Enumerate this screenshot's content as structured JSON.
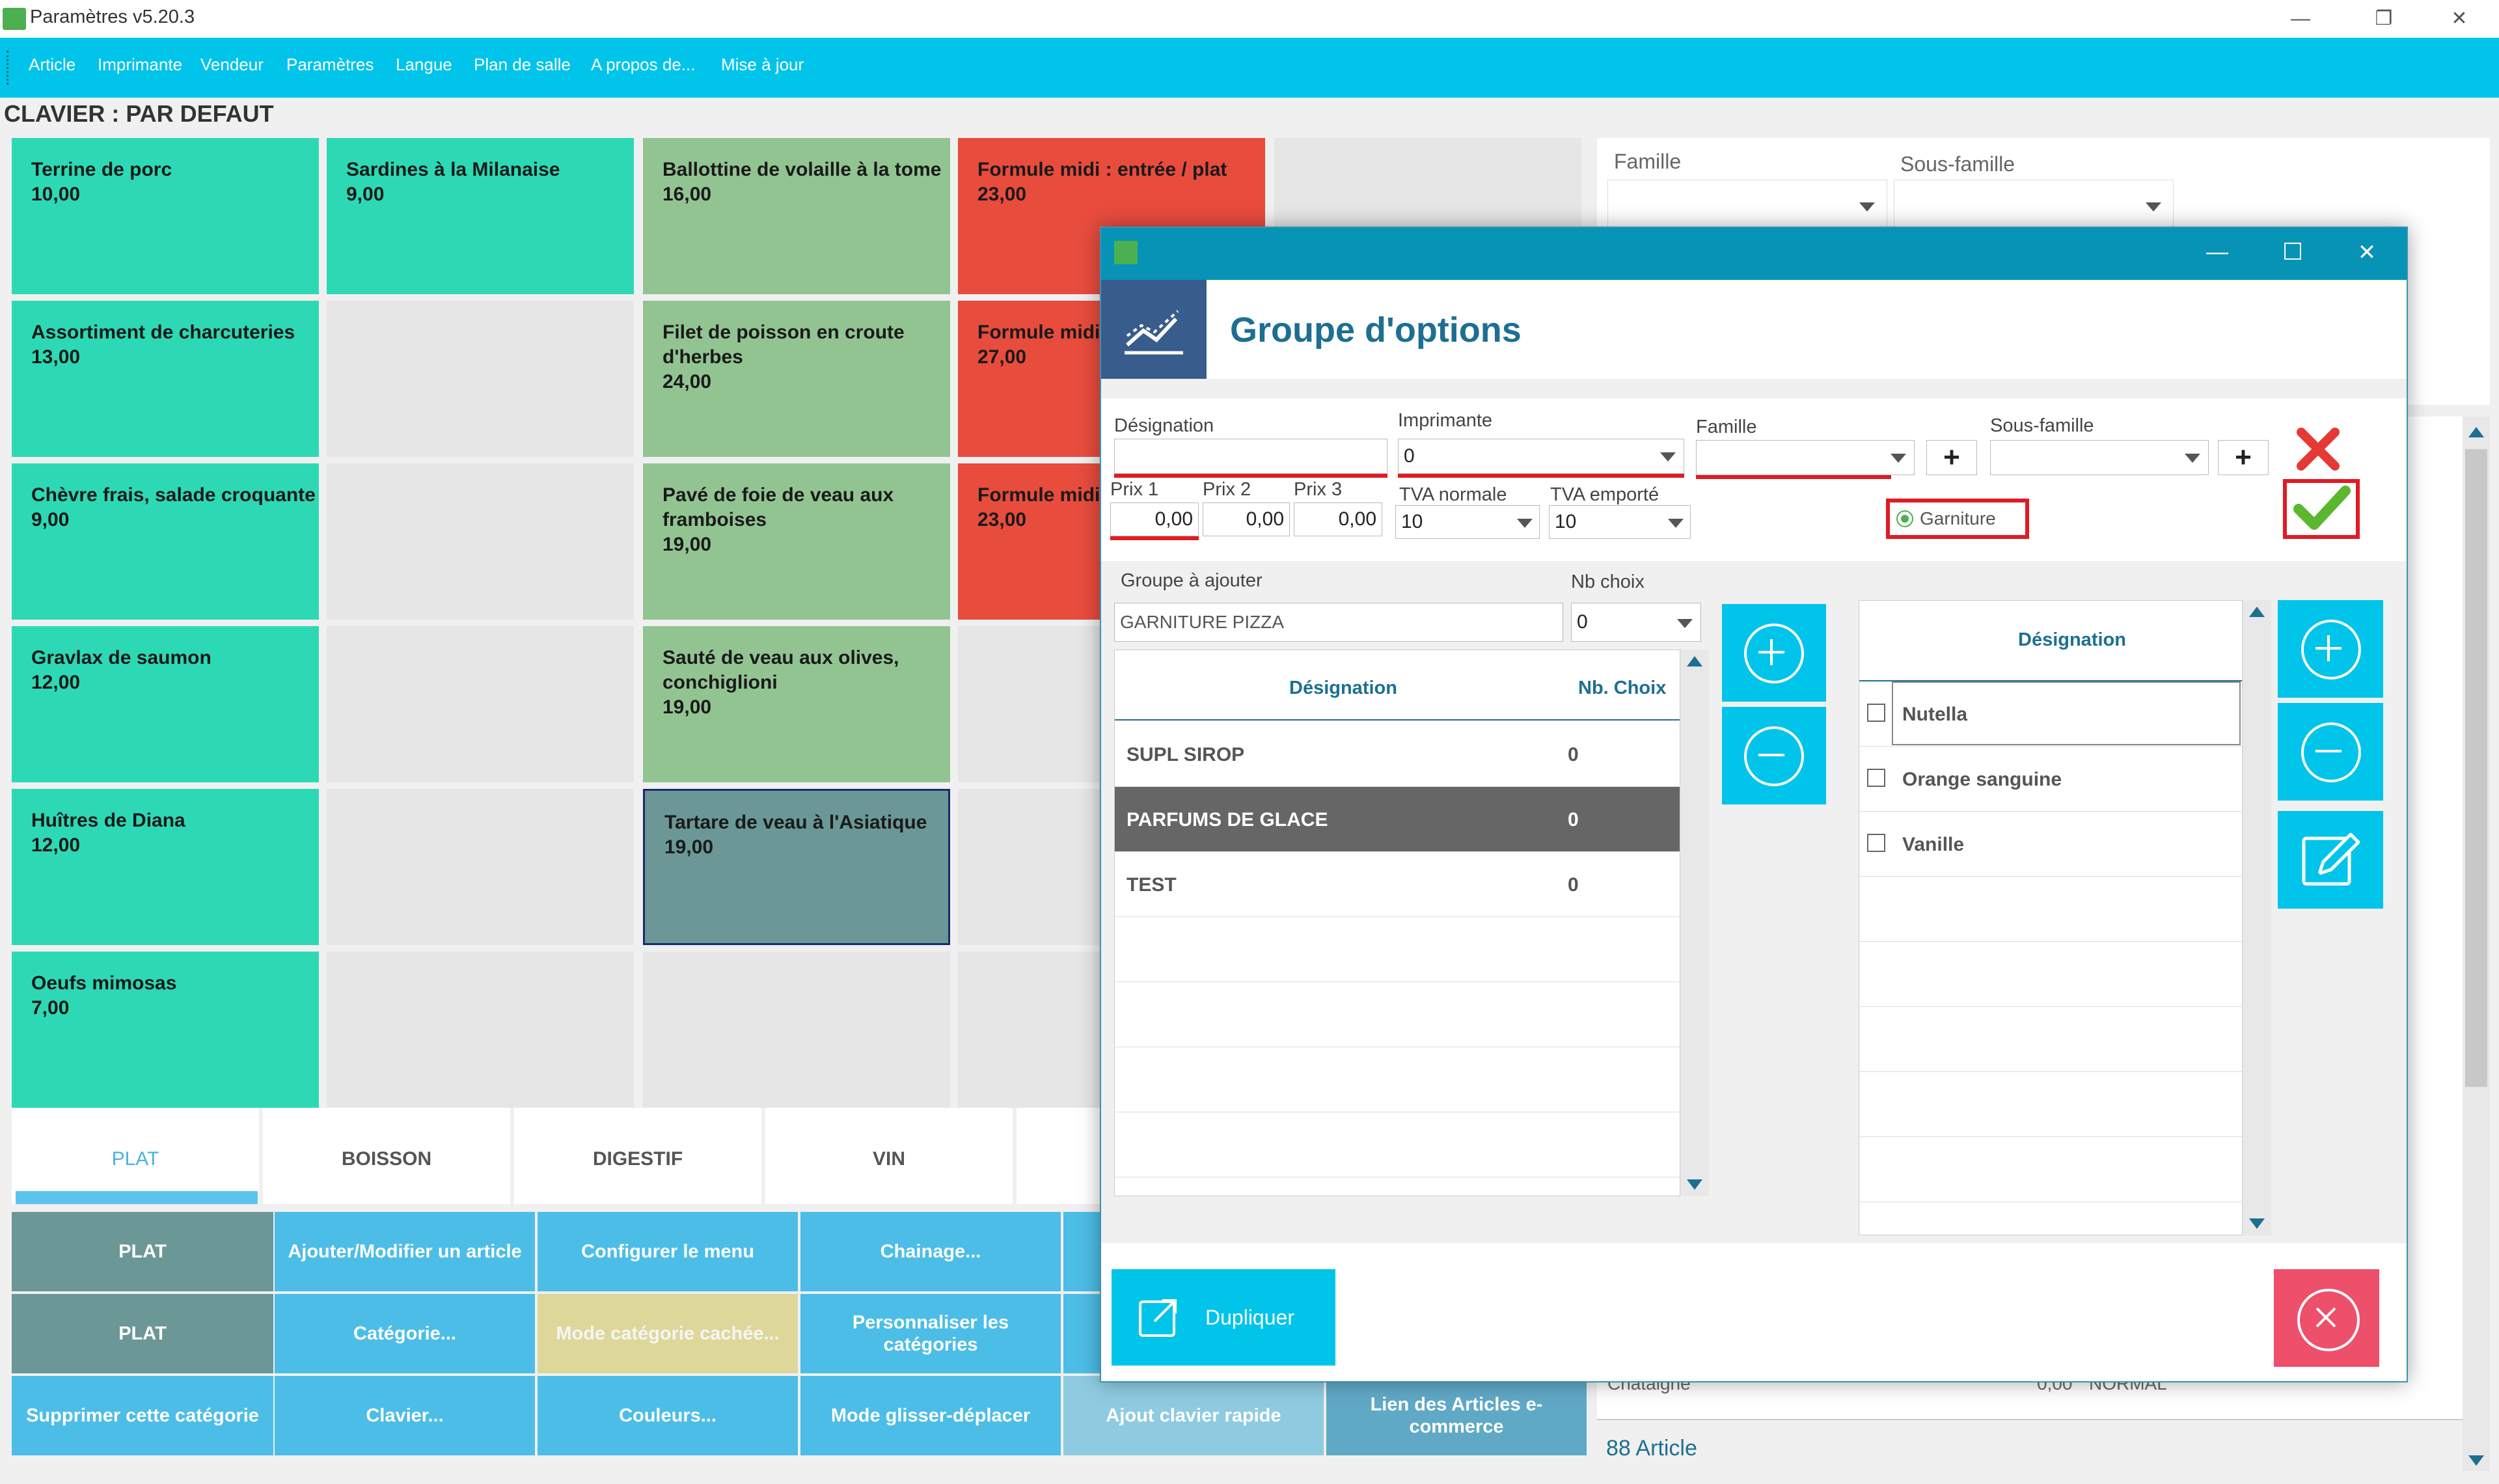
{
  "window": {
    "title": "Paramètres v5.20.3",
    "minimize": "—",
    "restore": "❐",
    "close": "✕"
  },
  "menu": [
    "Article",
    "Imprimante",
    "Vendeur",
    "Paramètres",
    "Langue",
    "Plan de salle",
    "A propos de...",
    "Mise à jour"
  ],
  "keyboard_title": "CLAVIER : PAR DEFAUT",
  "tiles": [
    {
      "name": "Terrine de porc",
      "price": "10,00"
    },
    {
      "name": "Sardines à la Milanaise",
      "price": "9,00"
    },
    {
      "name": "Ballottine de volaille à la tome",
      "price": "16,00"
    },
    {
      "name": "Formule midi : entrée / plat",
      "price": "23,00"
    },
    {
      "name": "Assortiment de charcuteries",
      "price": "13,00"
    },
    {
      "name": "Filet de poisson en croute d'herbes",
      "price": "24,00"
    },
    {
      "name": "Formule midi dessert",
      "price": "27,00"
    },
    {
      "name": "Chèvre frais, salade croquante",
      "price": "9,00"
    },
    {
      "name": "Pavé de foie de veau aux framboises",
      "price": "19,00"
    },
    {
      "name": "Formule midi",
      "price": "23,00"
    },
    {
      "name": "Gravlax de saumon",
      "price": "12,00"
    },
    {
      "name": "Sauté de veau aux olives, conchiglioni",
      "price": "19,00"
    },
    {
      "name": "Huîtres de Diana",
      "price": "12,00"
    },
    {
      "name": "Tartare de veau à l'Asiatique",
      "price": "19,00"
    },
    {
      "name": "Oeufs mimosas",
      "price": "7,00"
    }
  ],
  "category_tabs": [
    "PLAT",
    "BOISSON",
    "DIGESTIF",
    "VIN"
  ],
  "actions": {
    "r1": [
      "PLAT",
      "Ajouter/Modifier un article",
      "Configurer le menu",
      "Chainage..."
    ],
    "r2": [
      "PLAT",
      "Catégorie...",
      "Mode catégorie cachée...",
      "Personnaliser les catégories"
    ],
    "r3": [
      "Supprimer cette catégorie",
      "Clavier...",
      "Couleurs...",
      "Mode glisser-déplacer",
      "Ajout clavier rapide",
      "Lien des Articles e-commerce"
    ]
  },
  "right_panel": {
    "famille_label": "Famille",
    "sous_famille_label": "Sous-famille",
    "row_partial": "Chataigne",
    "row_partial_price": "0,00",
    "row_partial_type": "NORMAL",
    "footer": "88 Article"
  },
  "dialog": {
    "title": "Groupe d'options",
    "designation_label": "Désignation",
    "designation_value": "",
    "imprimante_label": "Imprimante",
    "imprimante_value": "0",
    "famille_label": "Famille",
    "sous_famille_label": "Sous-famille",
    "prix1_label": "Prix 1",
    "prix2_label": "Prix 2",
    "prix3_label": "Prix 3",
    "prix1": "0,00",
    "prix2": "0,00",
    "prix3": "0,00",
    "tva_normale_label": "TVA normale",
    "tva_normale": "10",
    "tva_emporte_label": "TVA emporté",
    "tva_emporte": "10",
    "garniture_label": "Garniture",
    "groupe_label": "Groupe à ajouter",
    "groupe_value": "GARNITURE PIZZA",
    "nb_choix_label": "Nb choix",
    "nb_choix_value": "0",
    "left_grid": {
      "headers": [
        "Désignation",
        "Nb. Choix"
      ],
      "rows": [
        {
          "name": "SUPL SIROP",
          "count": "0"
        },
        {
          "name": "PARFUMS DE GLACE",
          "count": "0"
        },
        {
          "name": "TEST",
          "count": "0"
        }
      ]
    },
    "right_grid": {
      "header": "Désignation",
      "rows": [
        "Nutella",
        "Orange sanguine",
        "Vanille"
      ]
    },
    "dupliquer": "Dupliquer",
    "plus_glyph": "+",
    "ctl": {
      "minimize": "—",
      "maximize": "☐",
      "close": "✕"
    }
  },
  "colors": {
    "accent": "#00c4ea",
    "dialog_bar": "#0693b5",
    "tile_teal": "#2dd9b5",
    "tile_green": "#92c492",
    "tile_red": "#e84c3d",
    "close_btn": "#ee4f6a"
  }
}
